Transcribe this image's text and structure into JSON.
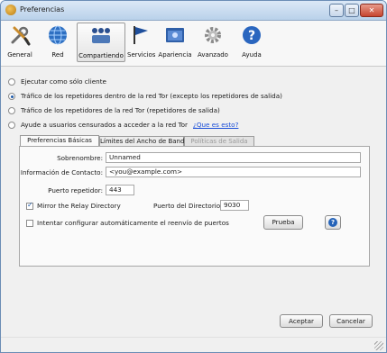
{
  "window": {
    "title": "Preferencias"
  },
  "toolbar": [
    {
      "id": "general",
      "label": "General",
      "icon": "wrench-screwdriver-icon"
    },
    {
      "id": "red",
      "label": "Red",
      "icon": "globe-icon"
    },
    {
      "id": "compartiendo",
      "label": "Compartiendo",
      "icon": "share-users-icon",
      "selected": true
    },
    {
      "id": "servicios",
      "label": "Servicios",
      "icon": "flag-icon"
    },
    {
      "id": "apariencia",
      "label": "Apariencia",
      "icon": "appearance-window-icon"
    },
    {
      "id": "avanzado",
      "label": "Avanzado",
      "icon": "gear-icon"
    },
    {
      "id": "ayuda",
      "label": "Ayuda",
      "icon": "help-icon"
    }
  ],
  "options": {
    "client_only": "Ejecutar como sólo cliente",
    "relay_traffic": "Tráfico de los repetidores dentro de la red Tor (excepto los repetidores de salida)",
    "exit_traffic": "Tráfico de los repetidores de la red Tor (repetidores de salida)",
    "bridge": "Ayude a usuarios censurados a acceder a la red Tor",
    "bridge_link": "¿Que es esto?",
    "selected": "relay_traffic"
  },
  "tabs": [
    {
      "label": "Preferencias Básicas",
      "state": "active"
    },
    {
      "label": "Límites del Ancho de Banda",
      "state": "normal"
    },
    {
      "label": "Políticas de Salida",
      "state": "disabled"
    }
  ],
  "basic": {
    "nickname_label": "Sobrenombre:",
    "nickname_value": "Unnamed",
    "contact_label": "Información de Contacto:",
    "contact_value": "<you@example.com>",
    "relay_port_label": "Puerto repetidor:",
    "relay_port_value": "443",
    "mirror_label": "Mirror the Relay Directory",
    "mirror_checked": true,
    "dir_port_label": "Puerto del Directorio:",
    "dir_port_value": "9030",
    "upnp_label": "Intentar configurar automáticamente el reenvío de puertos",
    "upnp_checked": false,
    "test_button": "Prueba"
  },
  "footer": {
    "accept": "Aceptar",
    "cancel": "Cancelar"
  }
}
